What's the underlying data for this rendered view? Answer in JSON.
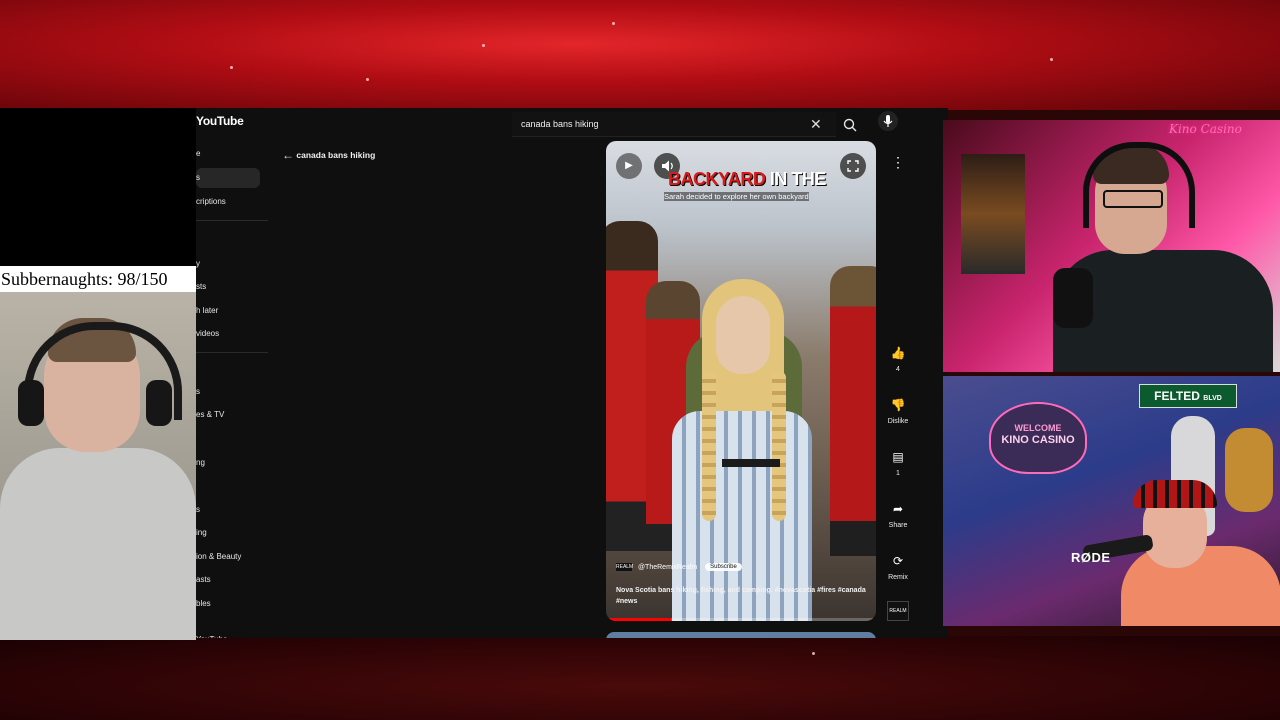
{
  "overlay": {
    "subbernaughts": "Subbernaughts: 98/150",
    "kino_logo": "Kino Casino",
    "rode_label": "RØDE",
    "welcome_sign": {
      "line1": "WELCOME",
      "line2": "KINO CASINO"
    },
    "felted_sign": {
      "name": "FELTED",
      "suffix": "BLVD"
    }
  },
  "youtube": {
    "logo": "YouTube",
    "search": {
      "query": "canada bans hiking"
    },
    "back_label": "canada bans hiking",
    "sidebar": {
      "items": [
        {
          "label": "e"
        },
        {
          "label": "s"
        },
        {
          "label": "criptions"
        },
        {
          "label": "y"
        },
        {
          "label": "sts"
        },
        {
          "label": "h later"
        },
        {
          "label": "videos"
        },
        {
          "label": "s"
        },
        {
          "label": "es & TV"
        },
        {
          "label": "ng"
        },
        {
          "label": "s"
        },
        {
          "label": "ing"
        },
        {
          "label": "ion & Beauty"
        },
        {
          "label": "asts"
        },
        {
          "label": "bles"
        },
        {
          "label": "YouTube"
        }
      ]
    },
    "short": {
      "caption_red": "BACKYARD",
      "caption_white": " IN THE",
      "subtitle": "Sarah decided to explore her own backyard",
      "channel_badge": "REALM",
      "channel": "@TheRemixRealm",
      "subscribe_label": "Subscribe",
      "description": "Nova Scotia bans hiking, fishing, and camping. #novascotia #fires #canada #news",
      "progress_fraction": 0.24
    },
    "actions": {
      "like_count": "4",
      "dislike_label": "Dislike",
      "comment_count": "1",
      "share_label": "Share",
      "remix_label": "Remix",
      "sound_badge": "REALM"
    }
  }
}
